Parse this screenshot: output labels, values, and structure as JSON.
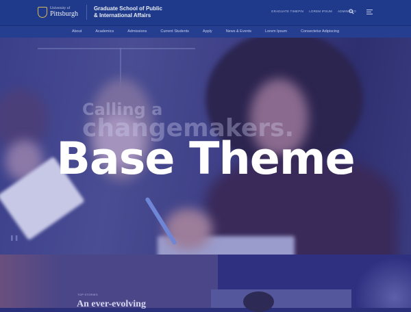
{
  "header": {
    "university_small": "University of",
    "university_big": "Pittsburgh",
    "school_line1": "Graduate School of Public",
    "school_line2": "& International Affairs",
    "utility_links": [
      "GRADUATE TIMEPIN",
      "LOREM IPSUM",
      "ADMINISEO"
    ]
  },
  "nav": {
    "items": [
      "About",
      "Academics",
      "Admissions",
      "Current Students",
      "Apply",
      "News & Events",
      "Lorem Ipsum",
      "Consectetur Adipiscing"
    ]
  },
  "hero": {
    "ghost_line1": "Calling a",
    "ghost_line2": "changemakers.",
    "title": "Base Theme"
  },
  "lower": {
    "eyebrow": "TOP STORIES",
    "heading": "An ever-evolving"
  }
}
